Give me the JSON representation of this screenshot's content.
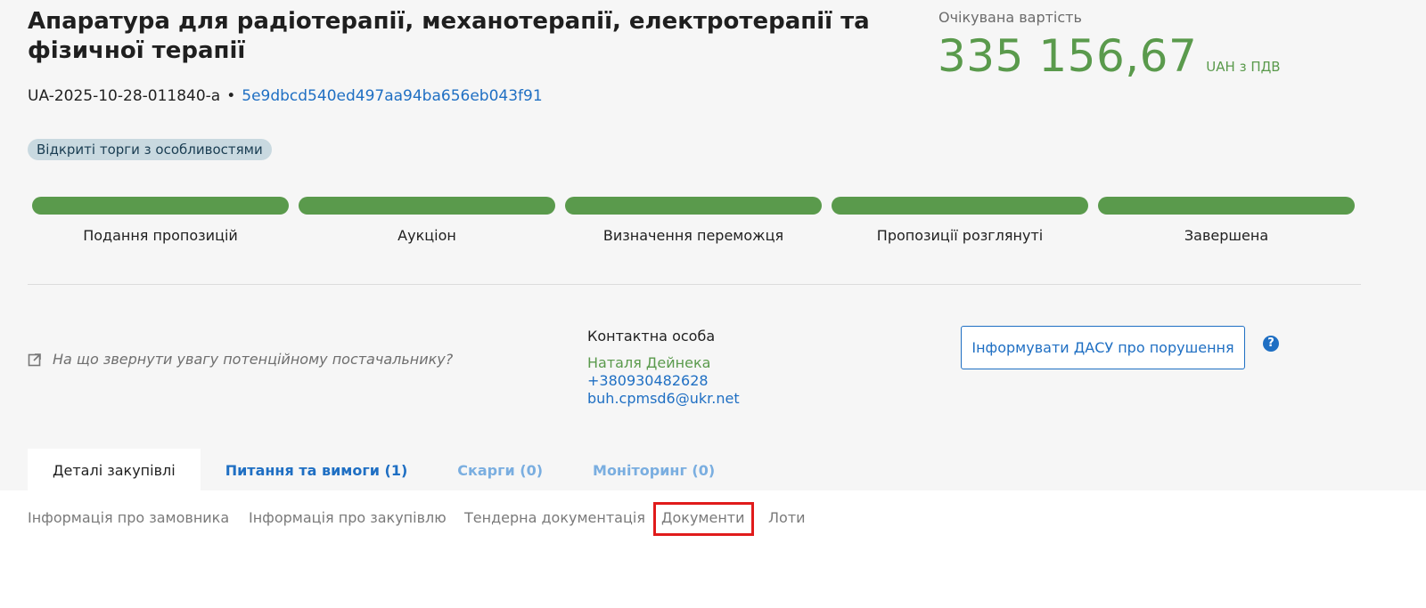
{
  "header": {
    "title": "Апаратура для радіотерапії, механотерапії, електротерапії та фізичної терапії",
    "tender_id": "UA-2025-10-28-011840-a",
    "separator": "•",
    "hash": "5e9dbcd540ed497aa94ba656eb043f91",
    "badge": "Відкриті торги з особливостями"
  },
  "expected_value": {
    "label": "Очікувана вартість",
    "amount": "335 156,67",
    "currency": "UAH з ПДВ"
  },
  "stages": [
    {
      "label": "Подання пропозицій",
      "complete": true
    },
    {
      "label": "Аукціон",
      "complete": true
    },
    {
      "label": "Визначення переможця",
      "complete": true
    },
    {
      "label": "Пропозиції розглянуті",
      "complete": true
    },
    {
      "label": "Завершена",
      "complete": true
    }
  ],
  "hint": {
    "text": "На що звернути увагу потенційному постачальнику?",
    "icon": "external-link-icon"
  },
  "contact": {
    "label": "Контактна особа",
    "name": "Наталя Дейнека",
    "phone": "+380930482628",
    "email": "buh.cpmsd6@ukr.net"
  },
  "report_button": {
    "label": "Інформувати ДАСУ про порушення",
    "help": "?"
  },
  "tabs": [
    {
      "label": "Деталі закупівлі",
      "state": "active"
    },
    {
      "label": "Питання та вимоги (1)",
      "state": "link"
    },
    {
      "label": "Скарги (0)",
      "state": "muted"
    },
    {
      "label": "Моніторинг (0)",
      "state": "muted"
    }
  ],
  "subnav": [
    {
      "label": "Інформація про замовника"
    },
    {
      "label": "Інформація про закупівлю"
    },
    {
      "label": "Тендерна документація"
    },
    {
      "label": "Документи",
      "highlighted": true
    },
    {
      "label": "Лоти"
    }
  ],
  "colors": {
    "accent_green": "#5a9a4c",
    "link_blue": "#1f6fc3",
    "highlight_red": "#e01b1b",
    "badge_bg": "#c9d9e0"
  }
}
